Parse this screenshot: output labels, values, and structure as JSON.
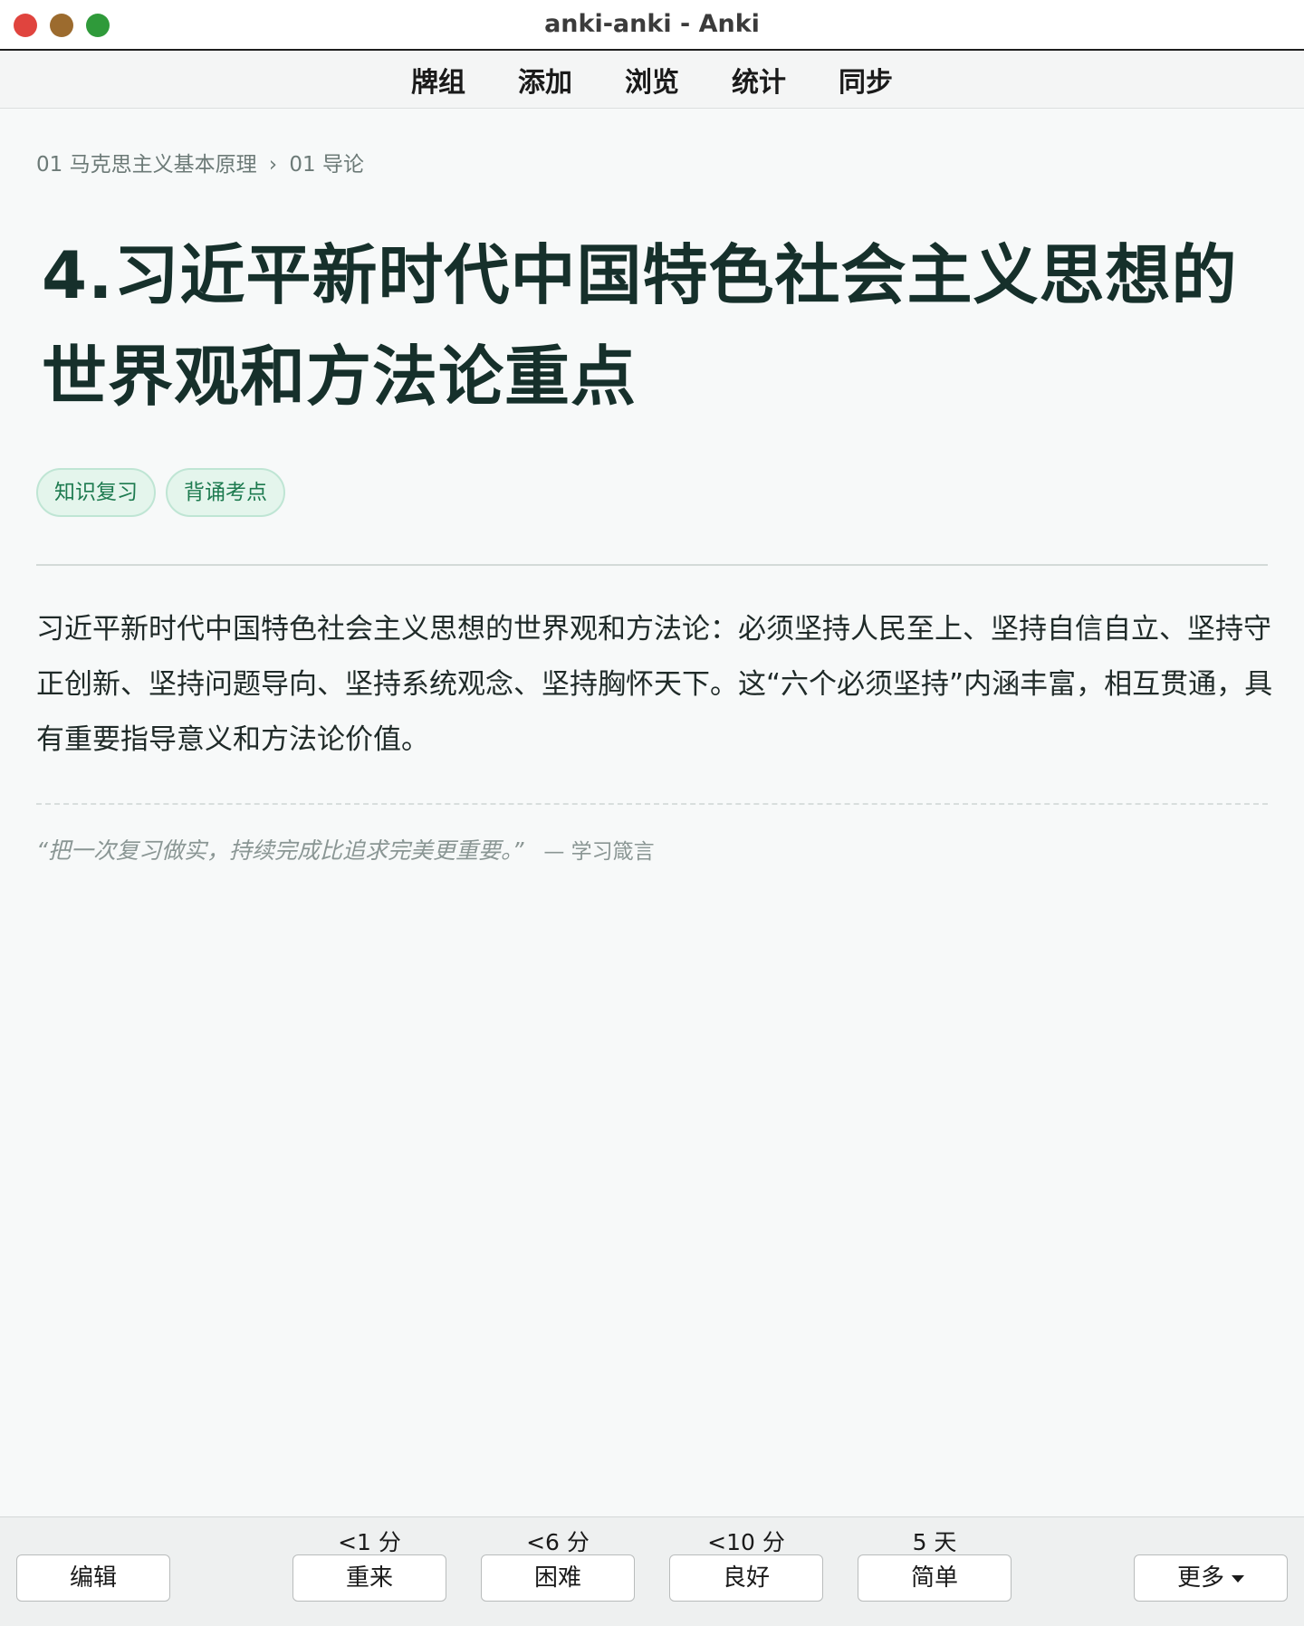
{
  "window": {
    "title": "anki-anki - Anki"
  },
  "nav": {
    "items": [
      {
        "label": "牌组"
      },
      {
        "label": "添加"
      },
      {
        "label": "浏览"
      },
      {
        "label": "统计"
      },
      {
        "label": "同步"
      }
    ]
  },
  "card": {
    "breadcrumb": {
      "deck": "01 马克思主义基本原理",
      "separator": "›",
      "subdeck": "01 导论"
    },
    "heading": "4.习近平新时代中国特色社会主义思想的世界观和方法论重点",
    "tags": [
      {
        "label": "知识复习"
      },
      {
        "label": "背诵考点"
      }
    ],
    "body": "习近平新时代中国特色社会主义思想的世界观和方法论：必须坚持人民至上、坚持自信自立、坚持守正创新、坚持问题导向、坚持系统观念、坚持胸怀天下。这“六个必须坚持”内涵丰富，相互贯通，具有重要指导意义和方法论价值。",
    "quote": {
      "text": "“把一次复习做实，持续完成比追求完美更重要。”",
      "source": "— 学习箴言"
    }
  },
  "review": {
    "edit_label": "编辑",
    "more_label": "更多",
    "more_icon": "caret-down-icon",
    "answers": [
      {
        "interval": "<1 分",
        "label": "重来"
      },
      {
        "interval": "<6 分",
        "label": "困难"
      },
      {
        "interval": "<10 分",
        "label": "良好"
      },
      {
        "interval": "5 天",
        "label": "简单"
      }
    ]
  },
  "colors": {
    "heading": "#16302b",
    "tag_bg": "#e4f5ec",
    "tag_text": "#1d7a4f",
    "traffic_close": "#e0443e",
    "traffic_min": "#9c6b2e",
    "traffic_max": "#2f9a3a"
  }
}
